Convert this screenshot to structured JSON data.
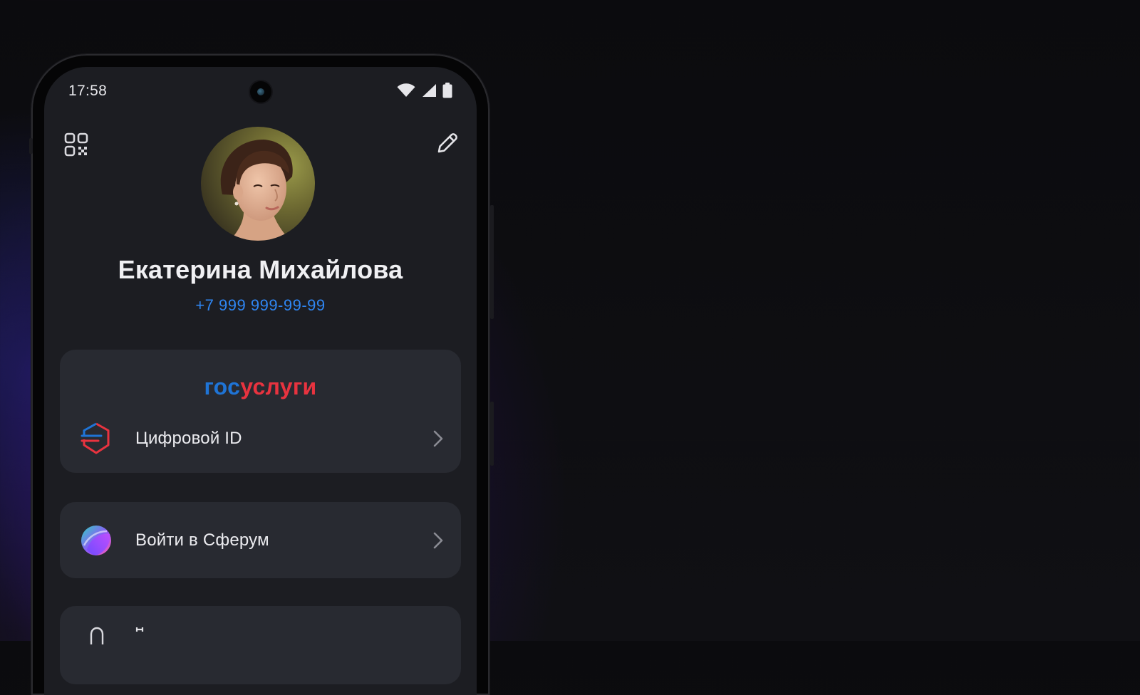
{
  "status_bar": {
    "time": "17:58",
    "icons": [
      "wifi-icon",
      "cellular-signal-icon",
      "battery-icon"
    ]
  },
  "header": {
    "qr_icon": "qr-code-icon",
    "edit_icon": "pencil-edit-icon"
  },
  "profile": {
    "name": "Екатерина Михайлова",
    "phone": "+7 999 999-99-99",
    "avatar": "profile-photo"
  },
  "gosuslugi_card": {
    "logo_part1": "гос",
    "logo_part2": "услуги",
    "item": {
      "label": "Цифровой ID",
      "icon": "digital-id-icon"
    }
  },
  "sferum_card": {
    "item": {
      "label": "Войти в Сферум",
      "icon": "sferum-logo-icon"
    }
  },
  "colors": {
    "accent_blue": "#2f86f3",
    "gos_blue": "#1f74d6",
    "gos_red": "#e8333f",
    "card_bg": "#282a31",
    "screen_bg": "#1c1d22"
  }
}
